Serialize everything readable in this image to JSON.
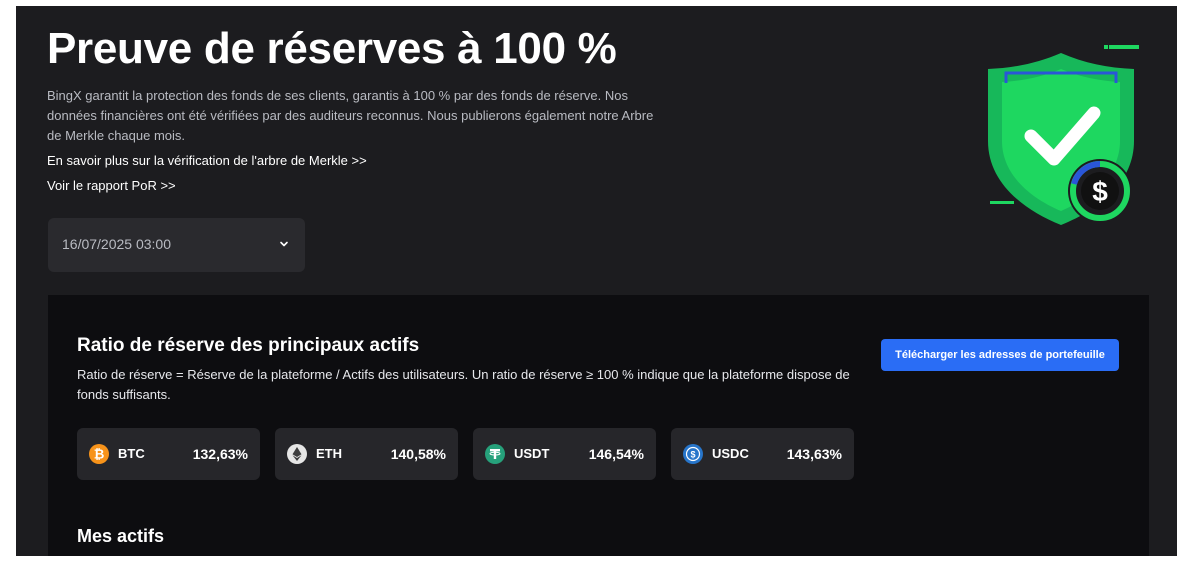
{
  "header": {
    "title": "Preuve de réserves à 100 %",
    "description": "BingX garantit la protection des fonds de ses clients, garantis à 100 % par des fonds de réserve. Nos données financières ont été vérifiées par des auditeurs reconnus. Nous publierons également notre Arbre de Merkle chaque mois.",
    "merkle_link": "En savoir plus sur la vérification de l'arbre de Merkle >>",
    "report_link": "Voir le rapport PoR >>"
  },
  "date_select": {
    "value": "16/07/2025 03:00"
  },
  "reserve": {
    "title": "Ratio de réserve des principaux actifs",
    "description": "Ratio de réserve = Réserve de la plateforme / Actifs des utilisateurs. Un ratio de réserve ≥ 100 % indique que la plateforme dispose de fonds suffisants.",
    "download_label": "Télécharger les adresses de portefeuille",
    "assets": [
      {
        "symbol": "BTC",
        "ratio": "132,63%",
        "icon": "btc-icon",
        "color": "#f7931a"
      },
      {
        "symbol": "ETH",
        "ratio": "140,58%",
        "icon": "eth-icon",
        "color": "#e6e6e6"
      },
      {
        "symbol": "USDT",
        "ratio": "146,54%",
        "icon": "usdt-icon",
        "color": "#26a17b"
      },
      {
        "symbol": "USDC",
        "ratio": "143,63%",
        "icon": "usdc-icon",
        "color": "#2775ca"
      }
    ]
  },
  "my_assets": {
    "title": "Mes actifs"
  },
  "colors": {
    "accent": "#2a6df5",
    "shield_green": "#1ed760",
    "background": "#1c1c1f",
    "panel": "#0d0d10"
  }
}
